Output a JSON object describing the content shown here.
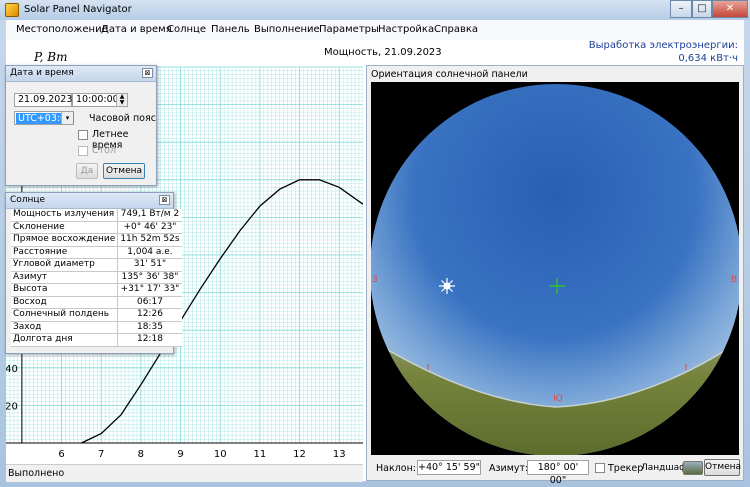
{
  "window": {
    "title": "Solar Panel Navigator",
    "controls": [
      "–",
      "□",
      "✕"
    ]
  },
  "menu": [
    "Местоположение",
    "Дата и время",
    "Солнце",
    "Панель",
    "Выполнение",
    "Параметры",
    "Настройка",
    "Справка"
  ],
  "header": {
    "unit_label": "P, Вт",
    "chart_title": "Мощность, 21.09.2023",
    "energy_label": "Выработка электроэнергии:",
    "energy_value": "0,634 кВт·ч"
  },
  "chart_data": {
    "type": "line",
    "x_ticks": [
      "6",
      "7",
      "8",
      "9",
      "10",
      "11",
      "12",
      "13"
    ],
    "y_ticks": [
      "20",
      "40"
    ],
    "xlim": [
      4.6,
      13.6
    ],
    "ylim": [
      0,
      200
    ],
    "series": [
      {
        "x": [
          6.5,
          7,
          7.5,
          8,
          8.5,
          9,
          9.5,
          10,
          10.5,
          11,
          11.5,
          12,
          12.5,
          13,
          13.6
        ],
        "y": [
          0,
          5,
          15,
          31,
          48,
          65,
          82,
          98,
          113,
          126,
          135,
          140,
          140,
          136,
          127
        ]
      }
    ],
    "grid": true,
    "line_color": "#000000",
    "grid_color": "#7fd8d8"
  },
  "status_bar": {
    "text": "Выполнено"
  },
  "datetime_dialog": {
    "title": "Дата и время",
    "date": "21.09.2023",
    "time": "10:00:00",
    "timezone": "UTC+03:00",
    "timezone_label": "Часовой пояс",
    "dst_label": "Летнее время",
    "table_label": "Стол",
    "ok_label": "Да",
    "cancel_label": "Отмена"
  },
  "sun_dialog": {
    "title": "Солнце",
    "rows": [
      {
        "label": "Мощность излучения",
        "value": "749,1 Вт/м 2"
      },
      {
        "label": "Склонение",
        "value": "+0° 46' 23\""
      },
      {
        "label": "Прямое восхождение",
        "value": "11h 52m 52s"
      },
      {
        "label": "Расстояние",
        "value": "1,004 а.е."
      },
      {
        "label": "Угловой диаметр",
        "value": "31' 51\""
      },
      {
        "label": "Азимут",
        "value": "135° 36' 38\""
      },
      {
        "label": "Высота",
        "value": "+31° 17' 33\""
      },
      {
        "label": "Восход",
        "value": "06:17"
      },
      {
        "label": "Солнечный полдень",
        "value": "12:26"
      },
      {
        "label": "Заход",
        "value": "18:35"
      },
      {
        "label": "Долгота дня",
        "value": "12:18"
      }
    ]
  },
  "orientation_panel": {
    "title": "Ориентация солнечной панели",
    "tilt_label": "Наклон:",
    "tilt_value": "+40° 15' 59\"",
    "azimuth_label": "Азимут:",
    "azimuth_value": "180° 00' 00\"",
    "tracker_label": "Трекер",
    "landscape_label": "Ландшафт",
    "cancel_label": "Отмена",
    "compass_labels": {
      "west": "З",
      "east": "В",
      "south": "Ю"
    },
    "sky_color_top": "#1e4fa0",
    "ground_color": "#6c7c3a"
  }
}
